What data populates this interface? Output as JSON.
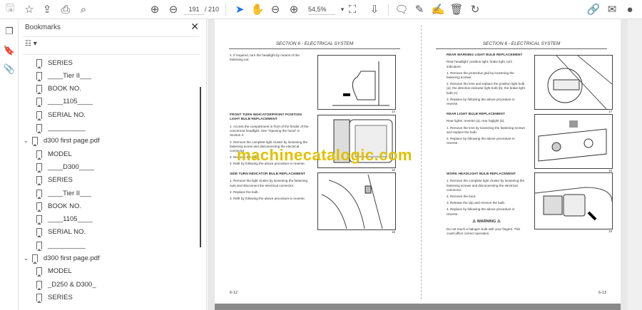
{
  "toolbar": {
    "page_current": "191",
    "page_total": "/ 210",
    "zoom": "54,5%"
  },
  "sidebar": {
    "title": "Bookmarks",
    "close": "✕",
    "items": [
      {
        "label": "SERIES",
        "level": 2
      },
      {
        "label": "____Tier II___",
        "level": 2
      },
      {
        "label": "BOOK NO.",
        "level": 2
      },
      {
        "label": "____1105____",
        "level": 2
      },
      {
        "label": "SERIAL NO.",
        "level": 2
      },
      {
        "label": "__________",
        "level": 2
      },
      {
        "label": "d300 first page.pdf",
        "level": 1
      },
      {
        "label": "MODEL",
        "level": 2
      },
      {
        "label": "____D300____",
        "level": 2
      },
      {
        "label": "SERIES",
        "level": 2
      },
      {
        "label": "____Tier II___",
        "level": 2
      },
      {
        "label": "BOOK NO.",
        "level": 2
      },
      {
        "label": "____1105____",
        "level": 2
      },
      {
        "label": "SERIAL NO.",
        "level": 2
      },
      {
        "label": "__________",
        "level": 2
      },
      {
        "label": "d300 first page.pdf",
        "level": 1
      },
      {
        "label": "MODEL",
        "level": 2
      },
      {
        "label": "_D250 & D300_",
        "level": 2
      },
      {
        "label": "SERIES",
        "level": 2
      }
    ]
  },
  "doc": {
    "left": {
      "header": "SECTION 6 - ELECTRICAL SYSTEM",
      "page_number": "6-12",
      "step4": "4.  If required, turn the headlight by means of the fastening nut.",
      "s1_title": "FRONT TURN INDICATOR/FRONT POSITION LIGHT BULB REPLACEMENT",
      "s1_steps": [
        "1.  Access the compartment in front of the fender of the concerned headlight. See \"Opening the hood\" in Section 4.",
        "2.  Remove the complete light cluster by loosening the fastening screw and disconnecting the electrical connector.",
        "3.  Remove the bulb.",
        "4.  Refit by following the above procedure in reverse."
      ],
      "s2_title": "SIDE TURN INDICATOR BULB REPLACEMENT",
      "s2_steps": [
        "1.  Remove the light cluster by loosening the fastening nuts and disconnect the electrical connector.",
        "2.  Replace the bulb.",
        "3.  Refit by following the above procedure in reverse."
      ],
      "figs": [
        "14",
        "15",
        "16"
      ]
    },
    "right": {
      "header": "SECTION 6 - ELECTRICAL SYSTEM",
      "page_number": "6-13",
      "s1_title": "REAR WARNING LIGHT BULB REPLACEMENT",
      "s1_intro": "Rear headlight: position light, brake light, turn indicators.",
      "s1_steps": [
        "1.  Remove the protective grid by loosening the fastening screws.",
        "2.  Remove the lens and replace the position light bulb (a), the direction indicator light bulb (b), the brake light bulb (c).",
        "3.  Replace by following the above procedure in reverse."
      ],
      "s2_title": "REAR LIGHT BULB REPLACEMENT",
      "s2_intro": "Rear lights: reverse (a), rear foglight (b).",
      "s2_steps": [
        "1.  Remove the lens by loosening the fastening screws and replace the bulb.",
        "2.  Replace by following the above procedure in reverse."
      ],
      "s3_title": "WORK HEADLIGHT BULB REPLACEMENT",
      "s3_steps": [
        "1.  Remove the complete light cluster by loosening the fastening screws and disconnecting the electrical connector.",
        "2.  Remove the boot.",
        "3.  Release the clip and remove the bulb.",
        "4.  Replace by following the above procedure in reverse."
      ],
      "warning_title": "⚠ WARNING ⚠",
      "warning_text": "Do not touch a halogen bulb with your fingers. This could affect correct operation.",
      "figs": [
        "17",
        "18",
        "19"
      ]
    },
    "watermark": "machinecatalogic.com"
  }
}
